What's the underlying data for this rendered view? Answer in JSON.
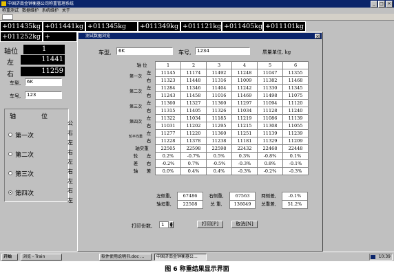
{
  "app": {
    "title": "中国济南金钟衡器公司称重管理系统",
    "menu": [
      "称重测试",
      "数据维护",
      "系统维护",
      "关于"
    ]
  },
  "weights_row1": [
    "+011435kg",
    "+011441kg",
    "+011345kg",
    "+011349kg",
    "+011121kg",
    "+011405kg",
    "+011101kg"
  ],
  "weights_row2": [
    "+011252kg",
    "+"
  ],
  "left_panel": {
    "axis_label": "轴位",
    "axis_value": "1",
    "left_label": "左",
    "left_value": "11441",
    "right_label": "右",
    "right_value": "11259",
    "model_label": "车型,",
    "model_value": "6K",
    "carno_label": "车号,",
    "carno_value": "123",
    "group_label": "轴",
    "group_label2": "位",
    "radios": [
      {
        "label": "第一次",
        "selected": false
      },
      {
        "label": "第二次",
        "selected": false
      },
      {
        "label": "第三次",
        "selected": false
      },
      {
        "label": "第四次",
        "selected": true
      }
    ],
    "side_chars": [
      "公",
      "右",
      "左",
      "右",
      "左",
      "右",
      "左",
      "右",
      "左"
    ]
  },
  "dialog": {
    "title": "测试数据浏览",
    "close": "×",
    "model_label": "车型,",
    "model_value": "6K",
    "carno_label": "车号,",
    "carno_value": "1234",
    "unit_label": "质量单位, kg",
    "axis_header": "轴 位",
    "axis_numbers": [
      "1",
      "2",
      "3",
      "4",
      "5",
      "6"
    ],
    "groups": [
      {
        "label": "第一次",
        "rows": [
          {
            "side": "左",
            "values": [
              "11145",
              "11174",
              "11492",
              "11248",
              "11047",
              "11355"
            ]
          },
          {
            "side": "右",
            "values": [
              "11323",
              "11448",
              "11316",
              "11009",
              "11382",
              "11468"
            ]
          }
        ]
      },
      {
        "label": "第二次",
        "rows": [
          {
            "side": "左",
            "values": [
              "11284",
              "11346",
              "11404",
              "11242",
              "11330",
              "11345"
            ]
          },
          {
            "side": "右",
            "values": [
              "11243",
              "11458",
              "11016",
              "11469",
              "11498",
              "11075"
            ]
          }
        ]
      },
      {
        "label": "第三次",
        "rows": [
          {
            "side": "左",
            "values": [
              "11360",
              "11327",
              "11360",
              "11297",
              "11094",
              "11120"
            ]
          },
          {
            "side": "右",
            "values": [
              "11315",
              "11405",
              "11326",
              "11034",
              "11128",
              "11240"
            ]
          }
        ]
      },
      {
        "label": "第四次",
        "rows": [
          {
            "side": "左",
            "values": [
              "11322",
              "11034",
              "11185",
              "11219",
              "11086",
              "11139"
            ]
          },
          {
            "side": "右",
            "values": [
              "11031",
              "11202",
              "11295",
              "11215",
              "11308",
              "11055"
            ]
          }
        ]
      },
      {
        "label": "轮平均重",
        "rows": [
          {
            "side": "左",
            "values": [
              "11277",
              "11220",
              "11360",
              "11251",
              "11139",
              "11239"
            ]
          },
          {
            "side": "右",
            "values": [
              "11228",
              "11378",
              "11238",
              "11181",
              "11329",
              "11209"
            ]
          }
        ]
      }
    ],
    "axle_weight": {
      "label": "轴实重",
      "values": [
        "22505",
        "22598",
        "22598",
        "22432",
        "22468",
        "22448"
      ]
    },
    "diff_label1": "轮",
    "diff_label2": "差",
    "diff_rows": [
      {
        "side": "左",
        "values": [
          "0.2%",
          "-0.7%",
          "0.5%",
          "0.3%",
          "-0.8%",
          "0.1%"
        ]
      },
      {
        "side": "右",
        "values": [
          "-0.2%",
          "0.7%",
          "-0.5%",
          "-0.3%",
          "0.8%",
          "-0.1%"
        ]
      }
    ],
    "axle_diff": {
      "label1": "轴",
      "label2": "差",
      "values": [
        "0.0%",
        "0.4%",
        "0.4%",
        "-0.3%",
        "-0.2%",
        "-0.3%"
      ]
    },
    "summary": [
      {
        "l1": "左侧重,",
        "v1": "67486",
        "l2": "右侧重,",
        "v2": "67563",
        "l3": "两侧差,",
        "v3": "-0.1%"
      },
      {
        "l1": "轴坦重,",
        "v1": "22508",
        "l2": "总 重,",
        "v2": "136049",
        "l3": "总重差,",
        "v3": "51.2%"
      }
    ],
    "copies_label": "打印份数,",
    "copies_value": "1",
    "print_button": "打印[P]",
    "cancel_button": "取消[N]"
  },
  "taskbar": {
    "start": "开始",
    "items": [
      "浏览 - Train",
      "软件使用说明书.doc ...",
      "中国济南金钟衡器公..."
    ],
    "clock": "10:39"
  },
  "caption": "图 6   称重结果显示界面"
}
